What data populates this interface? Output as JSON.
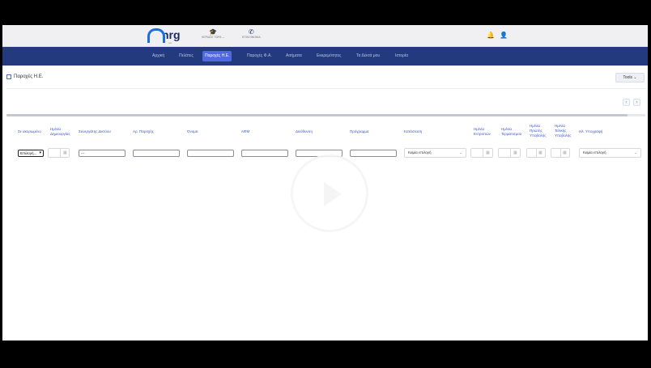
{
  "header": {
    "logo_text": "nrg",
    "top_links": [
      {
        "label": "ΚΕΡΔΙΣΕ ΤΩΡΑ",
        "icon": "graduation-cap-icon"
      },
      {
        "label": "ΕΠΙΚΟΙΝΩΝΙΑ",
        "icon": "phone-icon"
      }
    ],
    "icons": [
      "bell-icon",
      "user-icon"
    ],
    "accent": "#233a7e"
  },
  "nav": {
    "items": [
      "Αρχική",
      "Πελάτες",
      "Παροχές Η.Ε.",
      "Παροχές Φ.Α.",
      "Αιτήματα",
      "Εκκρεμότητες",
      "Τα Δέκτά μου",
      "Ιστορία"
    ],
    "active_index": 2
  },
  "page": {
    "title": "Παροχές Η.Ε.",
    "tools_label": "Tools",
    "pager_prev": "‹",
    "pager_next": "›"
  },
  "table": {
    "headers": [
      "Σε ακυρωμένο",
      "Ημ/νία Δημιουργίας",
      "Συνεργάτης Δικτύου",
      "Αρ. Παροχής",
      "Όνομα",
      "ΑΦΜ",
      "Διεύθυνση",
      "Πρόγραμμα",
      "Κατάσταση",
      "Ημ/νία Εντροπών",
      "Ημ/νία Τερματισμού",
      "Ημ/νία Πρώτης Υποβολής",
      "Ημ/νία Τελικής Υποβολής",
      "Ηλ. Υπογραφή"
    ],
    "filters": {
      "cancelled_select": "Επιλογή...",
      "partner_value": "---",
      "status_select": "Καμία επιλογή",
      "signature_select": "Καμία επιλογή"
    }
  }
}
